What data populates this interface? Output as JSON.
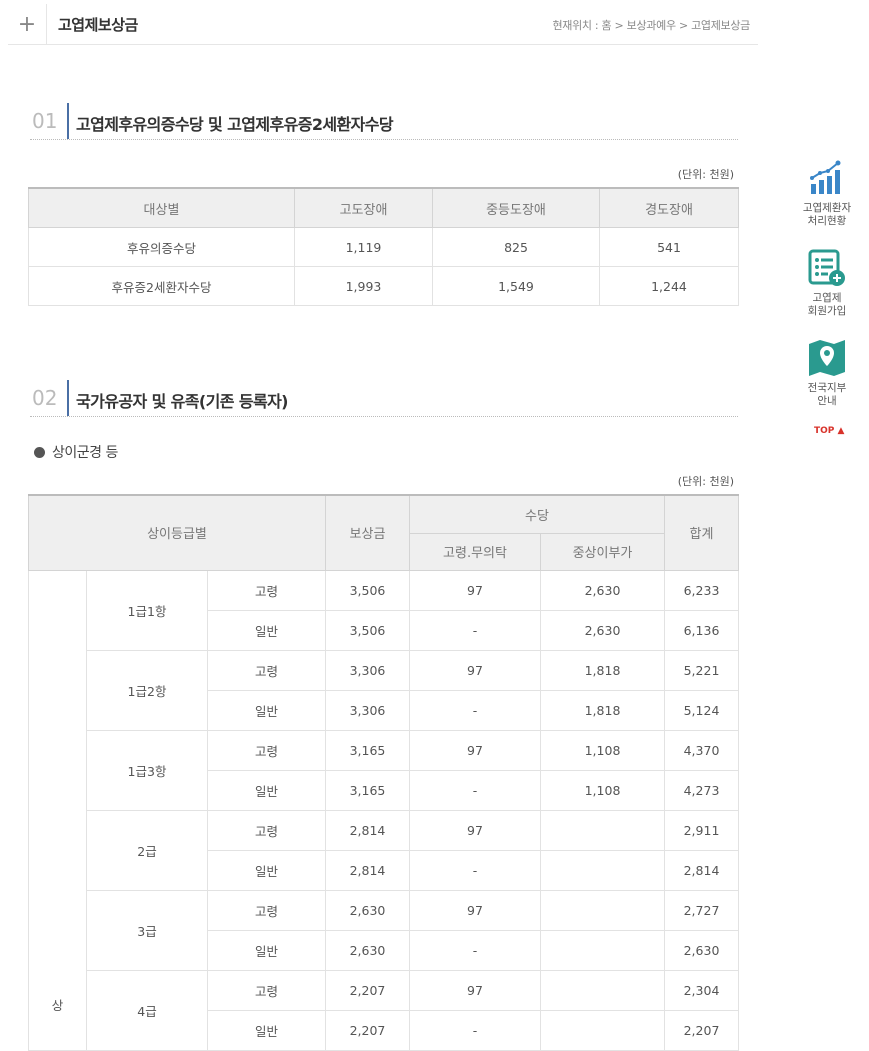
{
  "header": {
    "title": "고엽제보상금",
    "breadcrumb": "현재위치 : 홈 > 보상과예우 > 고엽제보상금"
  },
  "section1": {
    "number": "01",
    "title": "고엽제후유의증수당 및 고엽제후유증2세환자수당",
    "unit": "(단위: 천원)",
    "columns": [
      "대상별",
      "고도장애",
      "중등도장애",
      "경도장애"
    ],
    "rows": [
      [
        "후유의증수당",
        "1,119",
        "825",
        "541"
      ],
      [
        "후유증2세환자수당",
        "1,993",
        "1,549",
        "1,244"
      ]
    ]
  },
  "section2": {
    "number": "02",
    "title": "국가유공자 및 유족(기존 등록자)",
    "bullet": "상이군경 등",
    "unit": "(단위: 천원)",
    "head": {
      "grade": "상이등급별",
      "compensation": "보상금",
      "allowance": "수당",
      "allow_a": "고령.무의탁",
      "allow_b": "중상이부가",
      "total": "합계"
    },
    "side_label": "상",
    "groups": [
      {
        "grade": "1급1항",
        "rows": [
          [
            "고령",
            "3,506",
            "97",
            "2,630",
            "6,233"
          ],
          [
            "일반",
            "3,506",
            "-",
            "2,630",
            "6,136"
          ]
        ]
      },
      {
        "grade": "1급2항",
        "rows": [
          [
            "고령",
            "3,306",
            "97",
            "1,818",
            "5,221"
          ],
          [
            "일반",
            "3,306",
            "-",
            "1,818",
            "5,124"
          ]
        ]
      },
      {
        "grade": "1급3항",
        "rows": [
          [
            "고령",
            "3,165",
            "97",
            "1,108",
            "4,370"
          ],
          [
            "일반",
            "3,165",
            "-",
            "1,108",
            "4,273"
          ]
        ]
      },
      {
        "grade": "2급",
        "rows": [
          [
            "고령",
            "2,814",
            "97",
            "",
            "2,911"
          ],
          [
            "일반",
            "2,814",
            "-",
            "",
            "2,814"
          ]
        ]
      },
      {
        "grade": "3급",
        "rows": [
          [
            "고령",
            "2,630",
            "97",
            "",
            "2,727"
          ],
          [
            "일반",
            "2,630",
            "-",
            "",
            "2,630"
          ]
        ]
      },
      {
        "grade": "4급",
        "rows": [
          [
            "고령",
            "2,207",
            "97",
            "",
            "2,304"
          ],
          [
            "일반",
            "2,207",
            "-",
            "",
            "2,207"
          ]
        ]
      }
    ]
  },
  "quick_menu": [
    {
      "label1": "고엽제환자",
      "label2": "처리현황",
      "icon": "bar-chart-icon"
    },
    {
      "label1": "고엽제",
      "label2": "회원가입",
      "icon": "member-list-add-icon"
    },
    {
      "label1": "전국지부",
      "label2": "안내",
      "icon": "map-pin-icon"
    }
  ],
  "top_link": "TOP ▲",
  "colors": {
    "accent": "#4a6fa5",
    "icon_blue": "#3a86c8",
    "icon_teal": "#2a9a8f",
    "top_red": "#d8322a"
  }
}
